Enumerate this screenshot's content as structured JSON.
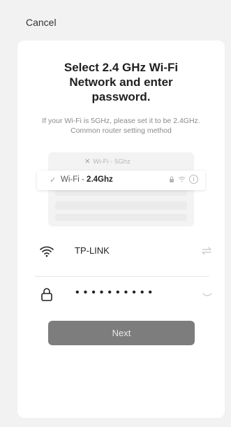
{
  "topbar": {
    "cancel_label": "Cancel"
  },
  "card": {
    "title": "Select 2.4 GHz Wi-Fi\nNetwork and enter\npassword.",
    "subtitle": "If your Wi-Fi is 5GHz, please set it to be 2.4GHz. Common router setting method",
    "illustration": {
      "row_5ghz": {
        "icon": "x-icon",
        "text": "Wi-Fi - 5Ghz"
      },
      "row_24ghz": {
        "icon": "check-icon",
        "prefix": "Wi-Fi - ",
        "bold": "2.4Ghz",
        "icons": [
          "lock-icon",
          "wifi-icon",
          "info-icon"
        ]
      }
    },
    "wifi_field": {
      "icon": "wifi-icon",
      "value": "TP-LINK",
      "action_icon": "swap-icon"
    },
    "password_field": {
      "icon": "lock-icon",
      "value": "••••••••••",
      "action_icon": "eye-closed-icon"
    },
    "next_label": "Next"
  },
  "colors": {
    "background": "#f2f2f2",
    "card": "#ffffff",
    "button": "#7d7d7d",
    "button_text": "#eaeaea"
  }
}
